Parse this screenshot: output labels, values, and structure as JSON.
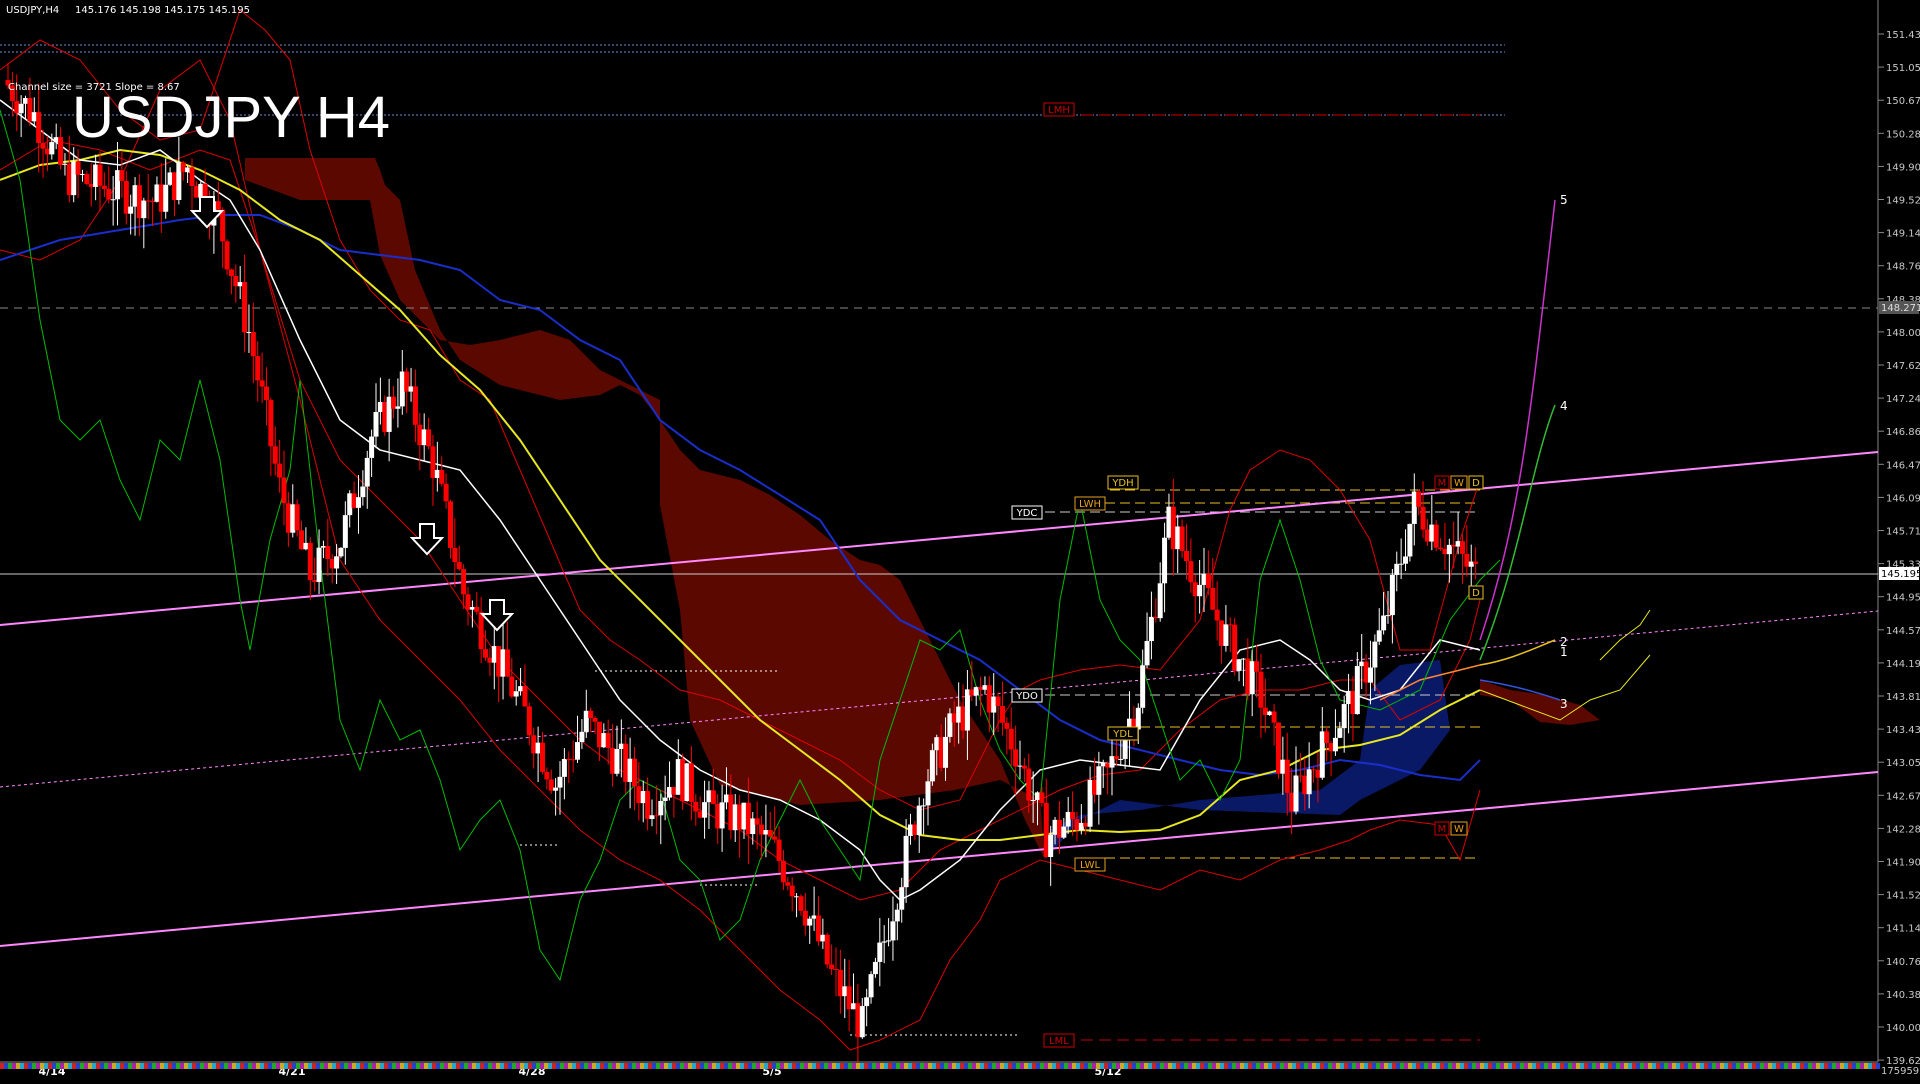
{
  "header": {
    "symbol": "USDJPY,H4",
    "ohlc": "145.176 145.198 145.175 145.195",
    "channel_info": "Channel size = 3721  Slope = 8.67",
    "big_title": "USDJPY H4"
  },
  "price_axis": {
    "labels": [
      "151.430",
      "151.050",
      "150.670",
      "150.280",
      "149.900",
      "149.520",
      "149.140",
      "148.760",
      "148.380",
      "148.000",
      "147.620",
      "147.240",
      "146.860",
      "146.470",
      "146.090",
      "145.710",
      "145.330",
      "144.950",
      "144.570",
      "144.190",
      "143.810",
      "143.430",
      "143.050",
      "142.670",
      "142.280",
      "141.900",
      "141.520",
      "141.140",
      "140.760",
      "140.380",
      "140.000",
      "139.620"
    ],
    "current_price": "145.195",
    "level_marker": "148.271",
    "bottom_label": "175959"
  },
  "time_axis": {
    "labels": [
      "4/14",
      "4/21",
      "4/28",
      "5/5",
      "5/12"
    ]
  },
  "level_tags": {
    "lmh": "LMH",
    "lml": "LML",
    "ydh": "YDH",
    "ydc": "YDC",
    "lwh": "LWH",
    "ydo": "YDO",
    "ydl": "YDL",
    "lwl": "LWL",
    "m_top": "M",
    "w_top": "W",
    "d_top": "D",
    "d_mid": "D",
    "m_bot": "M",
    "w_bot": "W"
  },
  "projection_labels": {
    "p1": "1",
    "p2": "2",
    "p3": "3",
    "p4": "4",
    "p5": "5"
  },
  "colors": {
    "background": "#000000",
    "bull_candle": "#ffffff",
    "bear_candle": "#ff0000",
    "trend_line": "#ff88ff",
    "ma_slow": "#1a2ecc",
    "ma_mid": "#e8e820",
    "ma_fast": "#ffffff",
    "bollinger": "#dd0000",
    "chikou": "#00bb00",
    "kumo_bear": "#aa1100",
    "kumo_bull": "#1133aa",
    "projection_5": "#cc33cc",
    "projection_4": "#33bb33"
  },
  "chart_data": {
    "type": "candlestick",
    "symbol": "USDJPY",
    "timeframe": "H4",
    "ylim": [
      139.5,
      151.6
    ],
    "current_price": 145.195,
    "x_ticks": [
      "4/14",
      "4/21",
      "4/28",
      "5/5",
      "5/12"
    ],
    "key_levels": {
      "LMH": 150.55,
      "LML": 139.85,
      "YDH": 146.27,
      "LWH": 146.0,
      "YDO": 143.75,
      "YDL": 143.35,
      "LWL": 141.95,
      "marker": 148.271
    },
    "close_path": [
      150.9,
      150.5,
      149.8,
      149.7,
      149.6,
      149.5,
      149.9,
      149.3,
      148.0,
      146.2,
      145.2,
      145.6,
      146.8,
      147.4,
      146.5,
      145.0,
      144.3,
      143.6,
      142.8,
      143.5,
      143.1,
      142.6,
      142.9,
      142.5,
      142.4,
      142.1,
      141.5,
      140.6,
      140.0,
      141.4,
      142.8,
      143.5,
      143.9,
      143.2,
      142.2,
      142.4,
      142.9,
      143.8,
      145.8,
      145.1,
      144.4,
      143.8,
      142.6,
      143.2,
      143.8,
      144.6,
      146.0,
      145.6,
      145.2
    ]
  }
}
